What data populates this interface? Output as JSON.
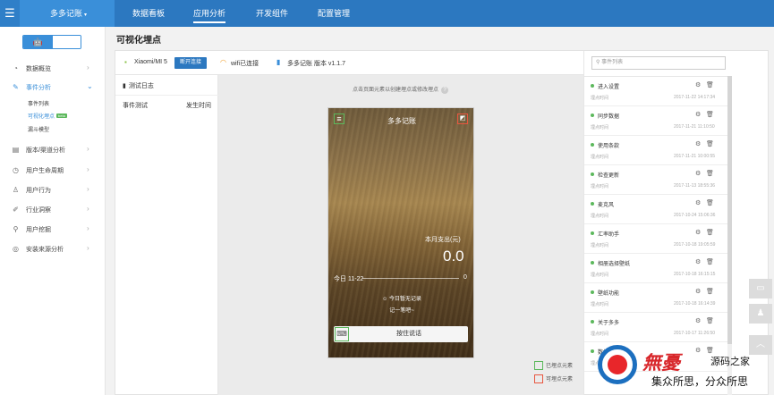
{
  "topbar": {
    "menu_icon": "hamburger-icon",
    "app_name": "多多记账",
    "app_caret": "▾",
    "nav": [
      {
        "label": "数据看板",
        "active": false
      },
      {
        "label": "应用分析",
        "active": true
      },
      {
        "label": "开发组件",
        "active": false
      },
      {
        "label": "配置管理",
        "active": false
      }
    ]
  },
  "sidebar": {
    "os": {
      "android_icon": "android-icon",
      "apple_icon": "apple-icon",
      "active": "android"
    },
    "items": [
      {
        "label": "数据概览",
        "icon": "clock-icon",
        "arrow": "›"
      },
      {
        "label": "事件分析",
        "icon": "edit-icon",
        "arrow": "⌄",
        "expanded": true
      },
      {
        "label": "版本/渠道分析",
        "icon": "layers-icon",
        "arrow": "›"
      },
      {
        "label": "用户生命周期",
        "icon": "cycle-icon",
        "arrow": "›"
      },
      {
        "label": "用户行为",
        "icon": "user-icon",
        "arrow": "›"
      },
      {
        "label": "行业洞察",
        "icon": "pencil-icon",
        "arrow": "›"
      },
      {
        "label": "用户挖掘",
        "icon": "search-icon",
        "arrow": "›"
      },
      {
        "label": "安装来源分析",
        "icon": "target-icon",
        "arrow": "›"
      }
    ],
    "subitems": [
      {
        "label": "事件列表",
        "active": false
      },
      {
        "label": "可视化埋点",
        "active": true,
        "badge": "beta"
      },
      {
        "label": "漏斗模型",
        "active": false
      }
    ]
  },
  "main": {
    "title": "可视化埋点",
    "device": {
      "name": "Xiaomi/MI 5",
      "disconnect": "断开连接",
      "wifi": "wifi已连接",
      "app_version": "多多记账 版本 v1.1.7"
    },
    "log": {
      "title": "测试日志",
      "col_event": "事件测试",
      "col_time": "发生时间"
    },
    "canvas": {
      "hint": "点击页面元素以创建埋点或修改埋点",
      "hint_icon": "?",
      "phone": {
        "title": "多多记账",
        "expense_label": "本月支出(元)",
        "expense_value": "0.0",
        "date": "今日 11-22",
        "today_amount": "0",
        "no_record": "今日暂无记录",
        "note": "记一笔吧~",
        "hold_to_talk": "按住说话"
      },
      "legend": [
        {
          "label": "已埋点元素",
          "color": "#5cb85c"
        },
        {
          "label": "可埋点元素",
          "color": "#e8563f"
        }
      ]
    },
    "events": {
      "search_placeholder": "事件列表",
      "items": [
        {
          "name": "进入设置",
          "label": "埋点时间",
          "time": "2017-11-22 14:17:34"
        },
        {
          "name": "同步数据",
          "label": "埋点时间",
          "time": "2017-11-21 11:10:50"
        },
        {
          "name": "使用条款",
          "label": "埋点时间",
          "time": "2017-11-21 10:00:55"
        },
        {
          "name": "检查更新",
          "label": "埋点时间",
          "time": "2017-11-13 18:55:36"
        },
        {
          "name": "麦克风",
          "label": "埋点时间",
          "time": "2017-10-24 15:06:36"
        },
        {
          "name": "汇率助手",
          "label": "埋点时间",
          "time": "2017-10-18 19:05:59"
        },
        {
          "name": "相册选择壁纸",
          "label": "埋点时间",
          "time": "2017-10-18 16:15:15"
        },
        {
          "name": "壁纸功能",
          "label": "埋点时间",
          "time": "2017-10-18 16:14:39"
        },
        {
          "name": "关于多多",
          "label": "埋点时间",
          "time": "2017-10-17 11:26:50"
        },
        {
          "name": "数据",
          "label": "埋点时间",
          "time": ""
        }
      ]
    }
  },
  "watermark": {
    "brand": "無憂",
    "right_top": "源码之家",
    "bottom": "集众所思，分众所思"
  }
}
